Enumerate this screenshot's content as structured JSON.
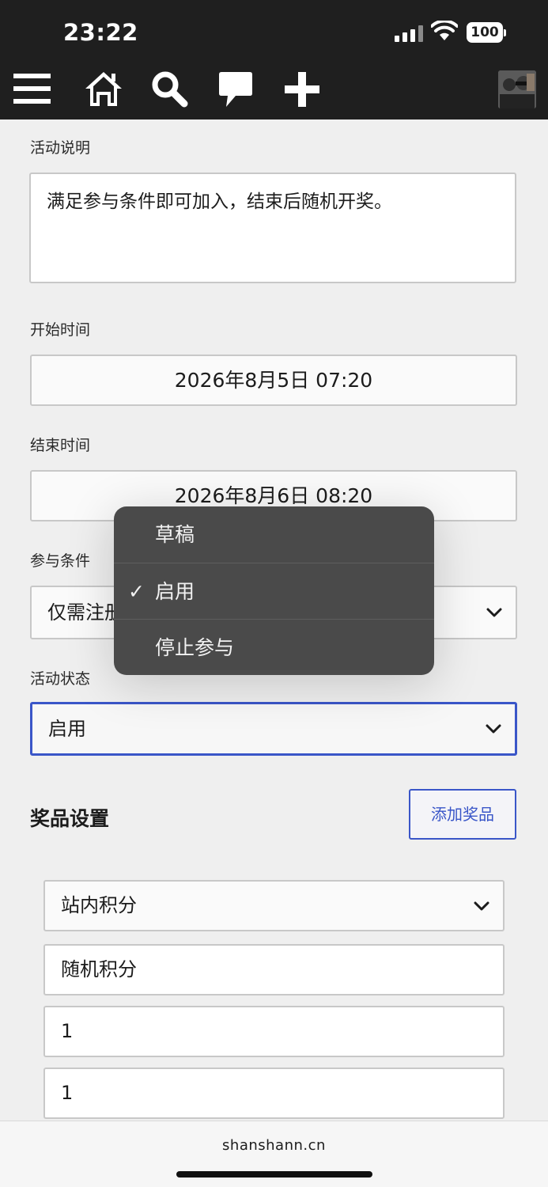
{
  "status_bar": {
    "time": "23:22",
    "battery": "100"
  },
  "nav": {
    "icons": [
      "menu-icon",
      "home-icon",
      "search-icon",
      "chat-icon",
      "plus-icon"
    ]
  },
  "form": {
    "description_label": "活动说明",
    "description_value": "满足参与条件即可加入，结束后随机开奖。",
    "start_label": "开始时间",
    "start_value": "2026年8月5日 07:20",
    "end_label": "结束时间",
    "end_value": "2026年8月6日 08:20",
    "condition_label": "参与条件",
    "condition_value": "仅需注册",
    "status_label": "活动状态",
    "status_value": "启用"
  },
  "dropdown": {
    "options": [
      "草稿",
      "启用",
      "停止参与"
    ],
    "selected": "启用"
  },
  "prizes": {
    "title": "奖品设置",
    "add_button": "添加奖品",
    "type_value": "站内积分",
    "name_value": "随机积分",
    "field3_value": "1",
    "field4_value": "1"
  },
  "browser": {
    "url": "shanshann.cn"
  },
  "colors": {
    "accent": "#3a56c8",
    "topbar": "#1f1f1f",
    "popup": "#4a4a4a"
  }
}
